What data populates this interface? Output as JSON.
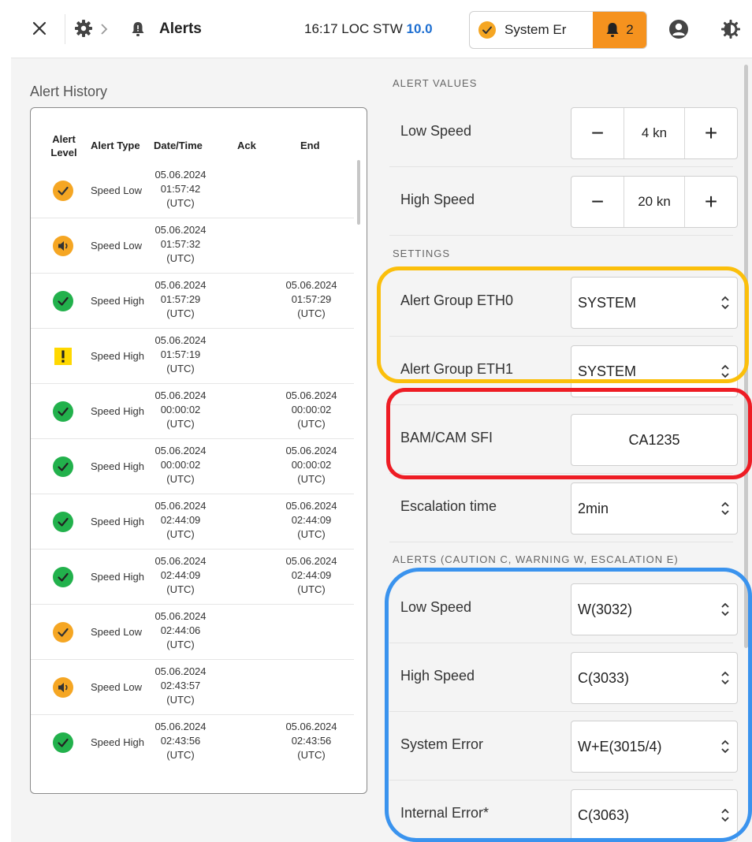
{
  "topbar": {
    "title": "Alerts",
    "time": "16:17",
    "loc_label": "LOC",
    "stw_label": "STW",
    "stw_value": "10.0",
    "status_text": "System Er",
    "alert_count": "2",
    "colors": {
      "stw": "#1e6fd1",
      "alert_badge": "#f5921e"
    },
    "icons": [
      "close-icon",
      "gear-icon",
      "chevron-right-icon",
      "bell-icon",
      "user-icon",
      "theme-icon"
    ]
  },
  "history": {
    "title": "Alert History",
    "headers": {
      "level_line1": "Alert",
      "level_line2": "Level",
      "type": "Alert Type",
      "datetime": "Date/Time",
      "ack": "Ack",
      "end": "End"
    },
    "rows": [
      {
        "level": "caution-ack",
        "type": "Speed Low",
        "date": "05.06.2024",
        "time": "01:57:42",
        "tz": "(UTC)",
        "end_date": "",
        "end_time": "",
        "end_tz": ""
      },
      {
        "level": "caution-active",
        "type": "Speed Low",
        "date": "05.06.2024",
        "time": "01:57:32",
        "tz": "(UTC)",
        "end_date": "",
        "end_time": "",
        "end_tz": ""
      },
      {
        "level": "resolved",
        "type": "Speed High",
        "date": "05.06.2024",
        "time": "01:57:29",
        "tz": "(UTC)",
        "end_date": "05.06.2024",
        "end_time": "01:57:29",
        "end_tz": "(UTC)"
      },
      {
        "level": "warning",
        "type": "Speed High",
        "date": "05.06.2024",
        "time": "01:57:19",
        "tz": "(UTC)",
        "end_date": "",
        "end_time": "",
        "end_tz": ""
      },
      {
        "level": "resolved",
        "type": "Speed High",
        "date": "05.06.2024",
        "time": "00:00:02",
        "tz": "(UTC)",
        "end_date": "05.06.2024",
        "end_time": "00:00:02",
        "end_tz": "(UTC)"
      },
      {
        "level": "resolved",
        "type": "Speed High",
        "date": "05.06.2024",
        "time": "00:00:02",
        "tz": "(UTC)",
        "end_date": "05.06.2024",
        "end_time": "00:00:02",
        "end_tz": "(UTC)"
      },
      {
        "level": "resolved",
        "type": "Speed High",
        "date": "05.06.2024",
        "time": "02:44:09",
        "tz": "(UTC)",
        "end_date": "05.06.2024",
        "end_time": "02:44:09",
        "end_tz": "(UTC)"
      },
      {
        "level": "resolved",
        "type": "Speed High",
        "date": "05.06.2024",
        "time": "02:44:09",
        "tz": "(UTC)",
        "end_date": "05.06.2024",
        "end_time": "02:44:09",
        "end_tz": "(UTC)"
      },
      {
        "level": "caution-ack",
        "type": "Speed Low",
        "date": "05.06.2024",
        "time": "02:44:06",
        "tz": "(UTC)",
        "end_date": "",
        "end_time": "",
        "end_tz": ""
      },
      {
        "level": "caution-active",
        "type": "Speed Low",
        "date": "05.06.2024",
        "time": "02:43:57",
        "tz": "(UTC)",
        "end_date": "",
        "end_time": "",
        "end_tz": ""
      },
      {
        "level": "resolved",
        "type": "Speed High",
        "date": "05.06.2024",
        "time": "02:43:56",
        "tz": "(UTC)",
        "end_date": "05.06.2024",
        "end_time": "02:43:56",
        "end_tz": "(UTC)"
      }
    ],
    "level_colors": {
      "caution": "#f5a623",
      "resolved": "#22b14c",
      "warning": "#ffd800"
    }
  },
  "settings": {
    "alert_values_title": "ALERT VALUES",
    "low_speed": {
      "label": "Low Speed",
      "value": "4 kn",
      "minus": "−",
      "plus": "+"
    },
    "high_speed": {
      "label": "High Speed",
      "value": "20 kn",
      "minus": "−",
      "plus": "+"
    },
    "settings_title": "SETTINGS",
    "group_eth0": {
      "label": "Alert Group ETH0",
      "value": "SYSTEM"
    },
    "group_eth1": {
      "label": "Alert Group ETH1",
      "value": "SYSTEM"
    },
    "bam_sfi": {
      "label": "BAM/CAM SFI",
      "value": "CA1235"
    },
    "escalation": {
      "label": "Escalation time",
      "value": "2min"
    },
    "alerts_title": "ALERTS (CAUTION C, WARNING W, ESCALATION E)",
    "alert_low_speed": {
      "label": "Low Speed",
      "value": "W(3032)"
    },
    "alert_high_speed": {
      "label": "High Speed",
      "value": "C(3033)"
    },
    "alert_system_error": {
      "label": "System Error",
      "value": "W+E(3015/4)"
    },
    "alert_internal_error": {
      "label": "Internal Error*",
      "value": "C(3063)"
    },
    "highlight_colors": {
      "settings_group": "#fbbf0b",
      "sfi": "#ee1c24",
      "alerts": "#3a93ee"
    }
  }
}
